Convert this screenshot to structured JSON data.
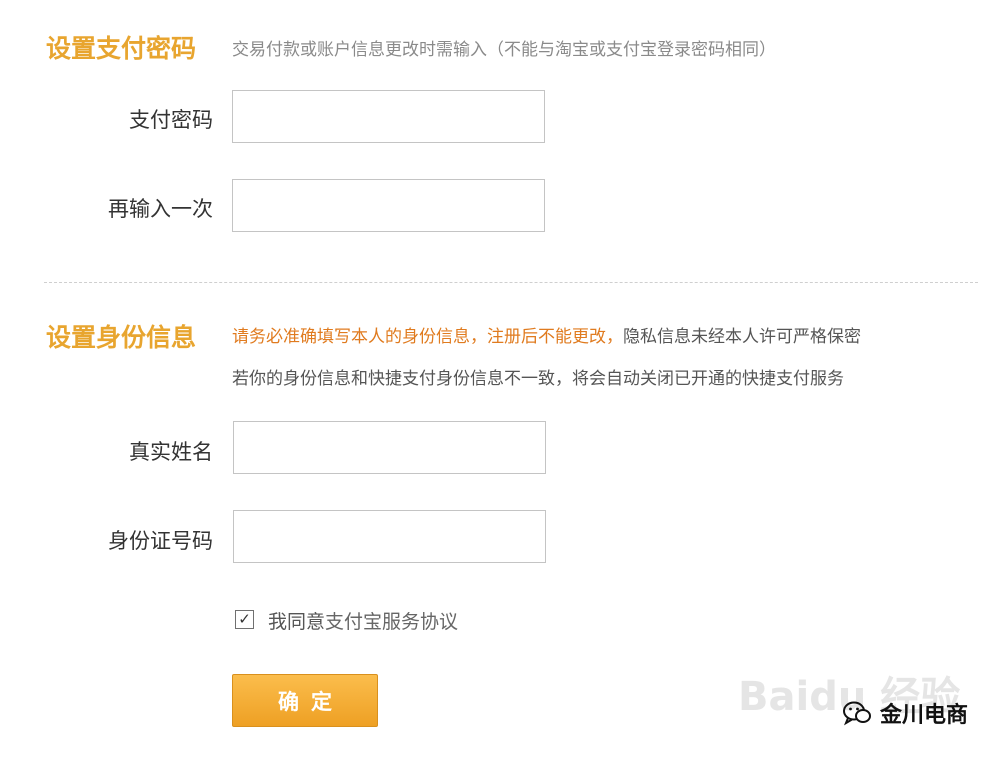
{
  "password_section": {
    "title": "设置支付密码",
    "hint": "交易付款或账户信息更改时需输入（不能与淘宝或支付宝登录密码相同）",
    "fields": [
      {
        "label": "支付密码",
        "value": ""
      },
      {
        "label": "再输入一次",
        "value": ""
      }
    ]
  },
  "identity_section": {
    "title": "设置身份信息",
    "hint_line1_orange": "请务必准确填写本人的身份信息，注册后不能更改，",
    "hint_line1_rest": "隐私信息未经本人许可严格保密",
    "hint_line2": "若你的身份信息和快捷支付身份信息不一致，将会自动关闭已开通的快捷支付服务",
    "fields": [
      {
        "label": "真实姓名",
        "value": ""
      },
      {
        "label": "身份证号码",
        "value": ""
      }
    ]
  },
  "agreement": {
    "checked": true,
    "check_mark": "✓",
    "prefix": "我同意",
    "link": "支付宝服务协议"
  },
  "submit_label": "确定",
  "watermark": "Baidu 经验",
  "brand": {
    "icon": "wechat-icon",
    "text": "金川电商"
  },
  "colors": {
    "accent": "#e8a52f",
    "warning_text": "#e07b1f",
    "button": "#f0a42a"
  }
}
